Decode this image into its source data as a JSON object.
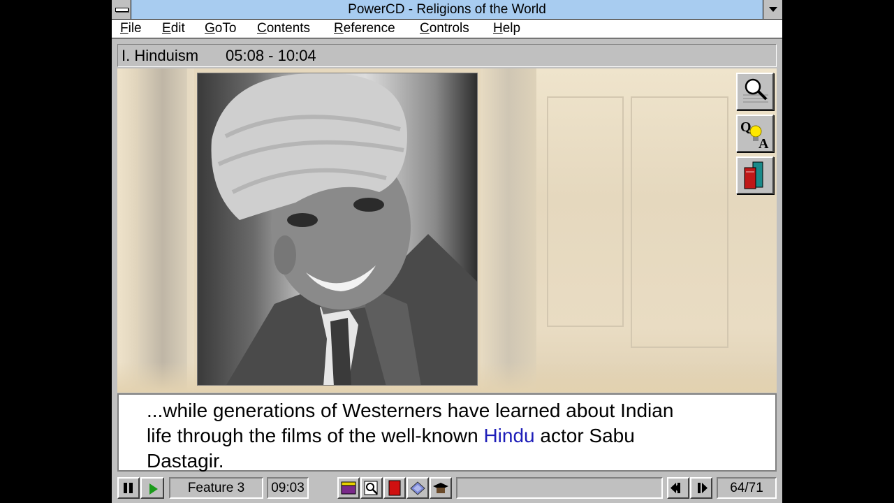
{
  "window": {
    "title": "PowerCD - Religions of the World"
  },
  "menu": [
    "File",
    "Edit",
    "GoTo",
    "Contents",
    "Reference",
    "Controls",
    "Help"
  ],
  "section": {
    "label": "I. Hinduism",
    "time_range": "05:08 - 10:04"
  },
  "caption": {
    "line1": "...while generations of Westerners have learned about Indian",
    "line2_before": "life through the films of the well-known ",
    "line2_link": "Hindu",
    "line2_after": " actor Sabu",
    "line3": "Dastagir."
  },
  "tools": [
    {
      "icon": "magnifier-icon",
      "name": "zoom"
    },
    {
      "icon": "qa-lightbulb-icon",
      "name": "questions-and-answers"
    },
    {
      "icon": "books-icon",
      "name": "reference"
    }
  ],
  "controls": {
    "feature": "Feature 3",
    "time": "09:03",
    "page": "64/71",
    "media_icons": [
      "clapboard-icon",
      "magnifier-doc-icon",
      "red-book-icon",
      "blue-tags-icon",
      "graduation-cap-icon"
    ]
  },
  "colors": {
    "titlebar": "#a8ccf0",
    "link": "#1d1db8",
    "play": "#1a9a1a"
  }
}
